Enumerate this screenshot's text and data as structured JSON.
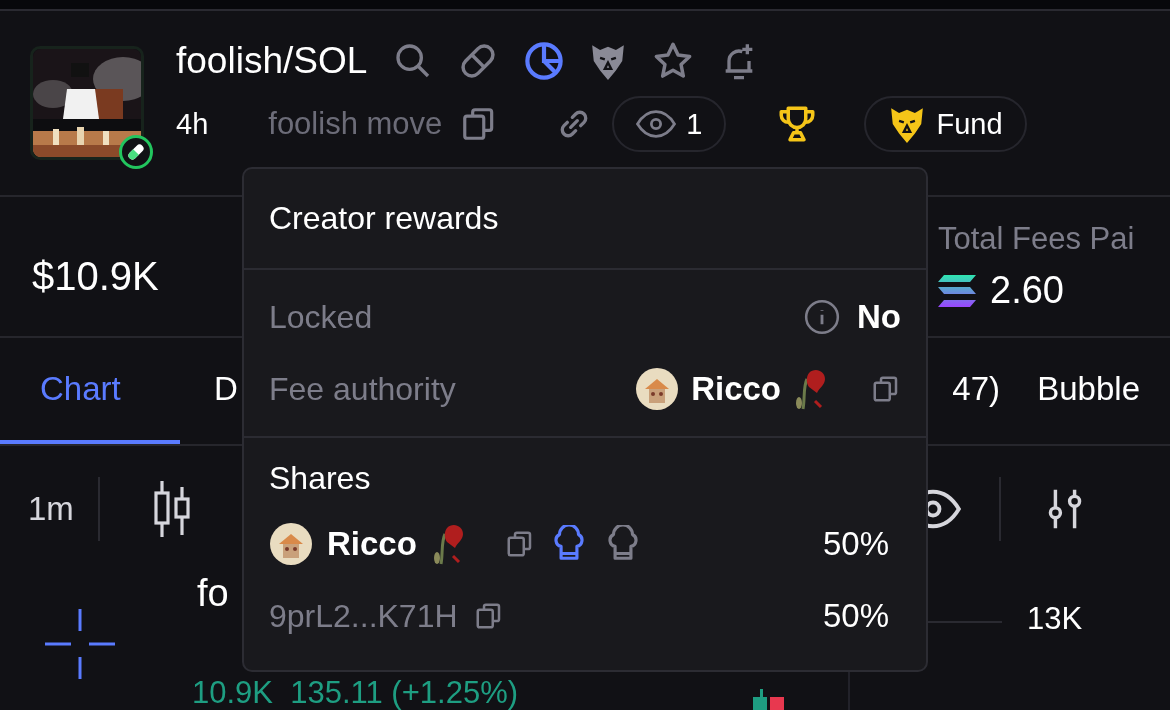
{
  "token": {
    "pair": "foolish/SOL",
    "age": "4h",
    "name": "foolish move",
    "watchers": "1",
    "fund_label": "Fund"
  },
  "stats": {
    "market_cap": "$10.9K",
    "fees_label": "Total Fees Pai",
    "fees_value": "2.60"
  },
  "tabs": [
    {
      "label": "Chart",
      "selected": true
    },
    {
      "label": "D",
      "selected": false
    },
    {
      "label": "47)",
      "selected": false
    },
    {
      "label": "Bubble",
      "selected": false
    }
  ],
  "toolbar": {
    "interval": "1m"
  },
  "chart": {
    "title": "fo",
    "ohlc": "10.9K  135.11 (+1.25%)",
    "axis_label": "13K"
  },
  "popup": {
    "title": "Creator rewards",
    "rows": [
      {
        "label": "Locked",
        "value": "No",
        "kind": "info"
      },
      {
        "label": "Fee authority",
        "value": "Ricco",
        "kind": "user"
      }
    ],
    "shares_title": "Shares",
    "shares": [
      {
        "holder": "Ricco",
        "kind": "user",
        "percent": "50%",
        "roles": [
          {
            "selected": true
          },
          {
            "selected": false
          }
        ]
      },
      {
        "holder": "9prL2...K71H",
        "kind": "address",
        "percent": "50%"
      }
    ]
  }
}
